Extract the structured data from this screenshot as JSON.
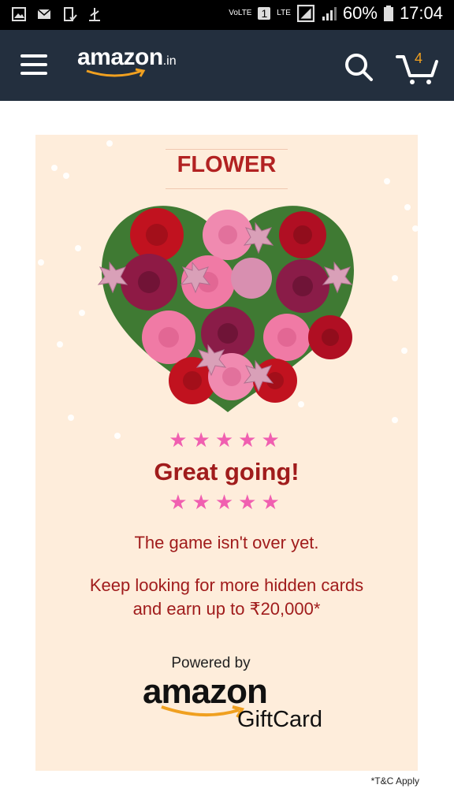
{
  "status_bar": {
    "network_label": "VoLTE",
    "sim": "1",
    "lte": "LTE",
    "battery": "60%",
    "time": "17:04"
  },
  "navbar": {
    "logo_text": "amazon",
    "logo_suffix": ".in",
    "cart_count": "4",
    "bg_color": "#232f3e"
  },
  "card": {
    "title": "FLOWER",
    "stars": "★★★★★",
    "headline": "Great going!",
    "message": "The game isn't over yet.",
    "message2_line1": "Keep looking for more hidden cards",
    "message2_line2": "and earn up to ₹20,000*",
    "powered_by": "Powered by",
    "brand": "amazon",
    "brand_sub": "GiftCard",
    "bg_color": "#feeddb",
    "accent_color": "#a01c1c"
  },
  "footer": {
    "tnc": "*T&C Apply"
  },
  "icons": [
    "gallery-icon",
    "mail-icon",
    "device-check-icon",
    "usb-icon",
    "signal-icon",
    "battery-icon",
    "menu-icon",
    "search-icon",
    "cart-icon",
    "heart-flowers-image"
  ]
}
